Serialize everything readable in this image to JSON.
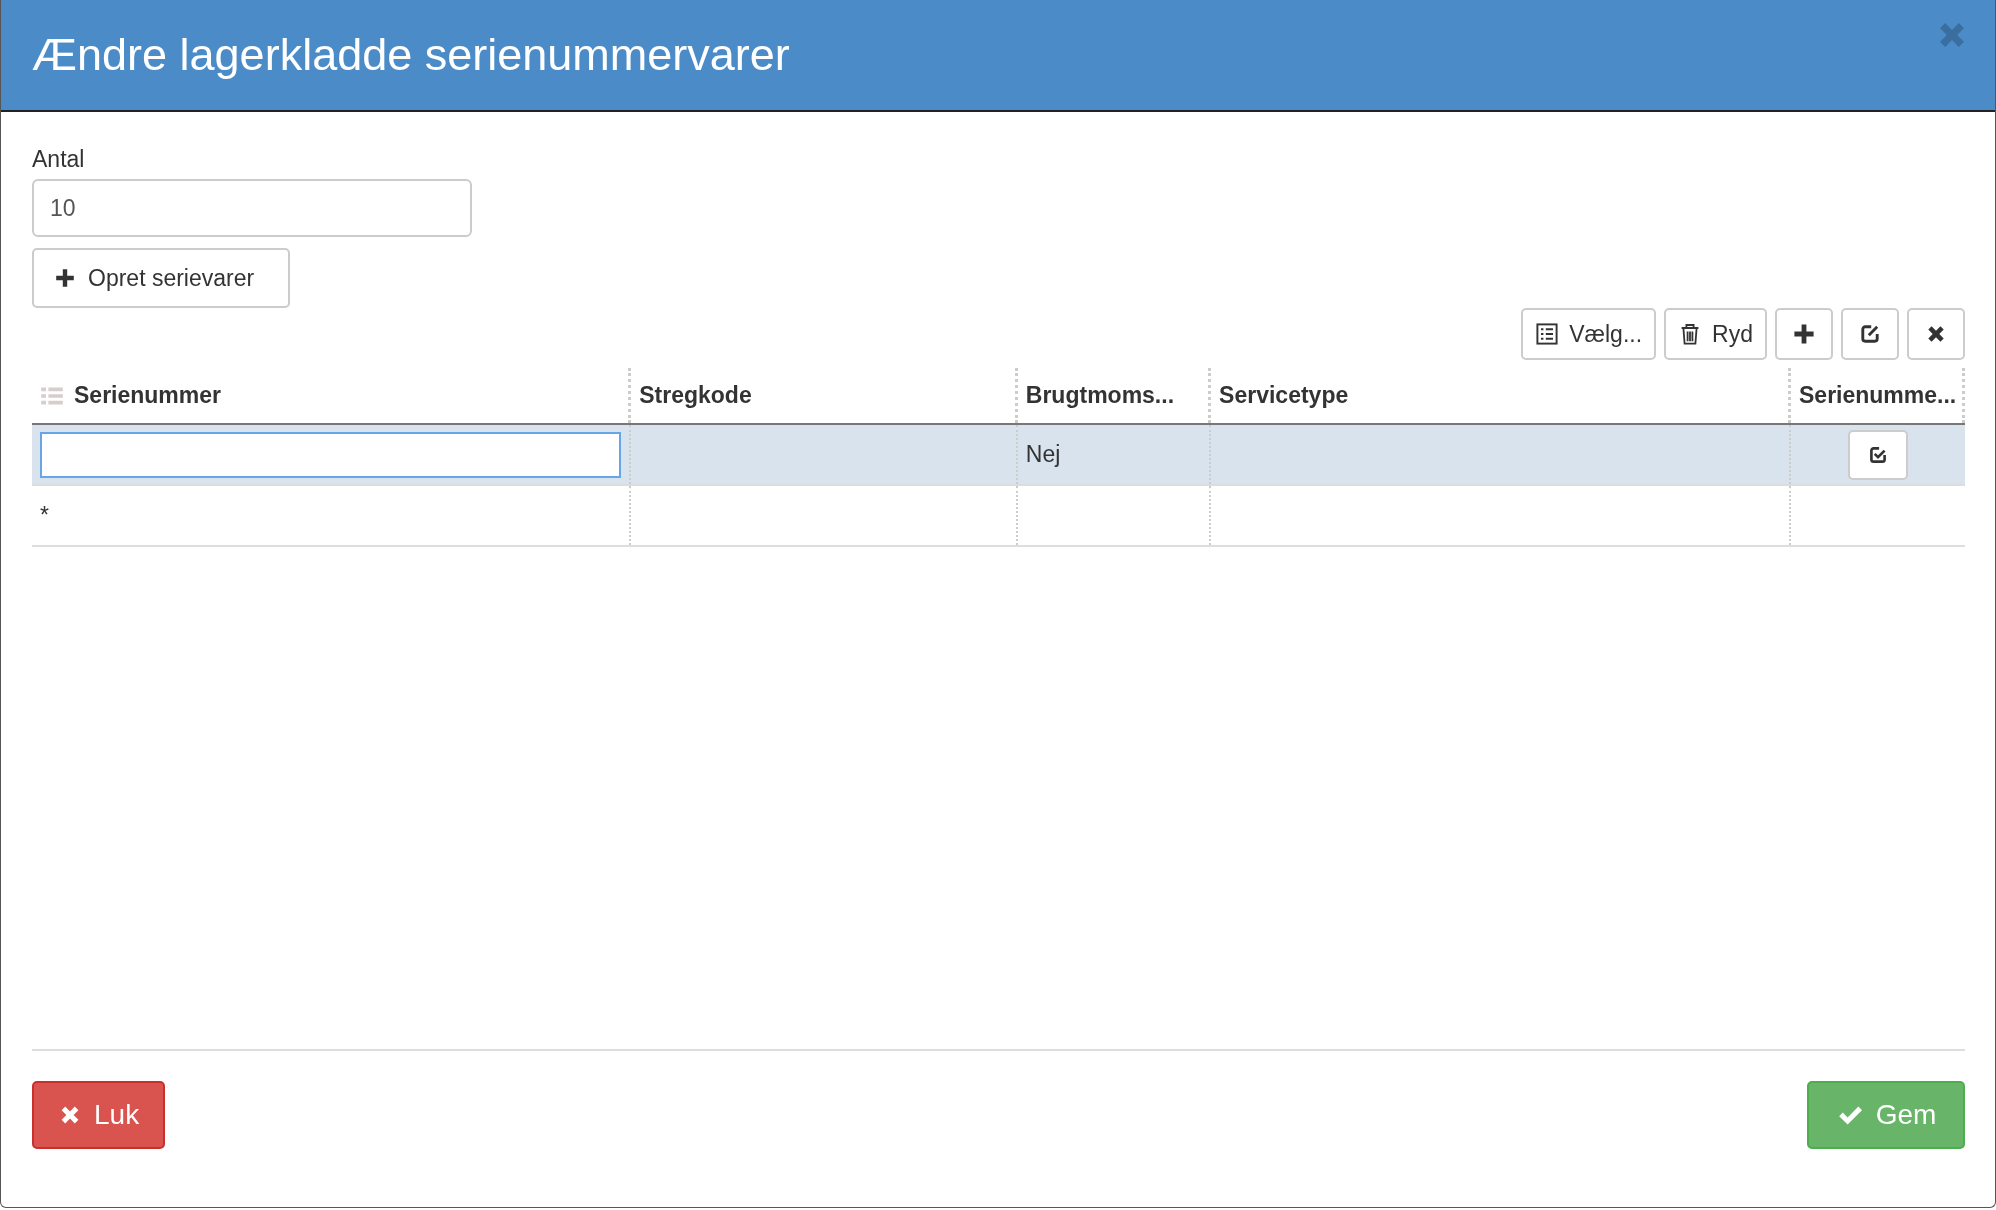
{
  "dialog": {
    "title": "Ændre lagerkladde serienummervarer"
  },
  "quantity": {
    "label": "Antal",
    "value": "10"
  },
  "create_button": {
    "label": "Opret serievarer"
  },
  "toolbar": [
    {
      "kind": "choose",
      "label": "Vælg..."
    },
    {
      "kind": "clear",
      "label": "Ryd"
    },
    {
      "kind": "add"
    },
    {
      "kind": "edit"
    },
    {
      "kind": "delete"
    }
  ],
  "table": {
    "columns": [
      "Serienummer",
      "Stregkode",
      "Brugtmoms...",
      "Servicetype",
      "Serienumme..."
    ],
    "rows": [
      {
        "kind": "editing",
        "selected": true,
        "column_3": "Nej"
      },
      {
        "kind": "new",
        "selected": false,
        "marker": "*"
      }
    ]
  },
  "footer": {
    "close_button": "Luk",
    "save_button": "Gem"
  }
}
